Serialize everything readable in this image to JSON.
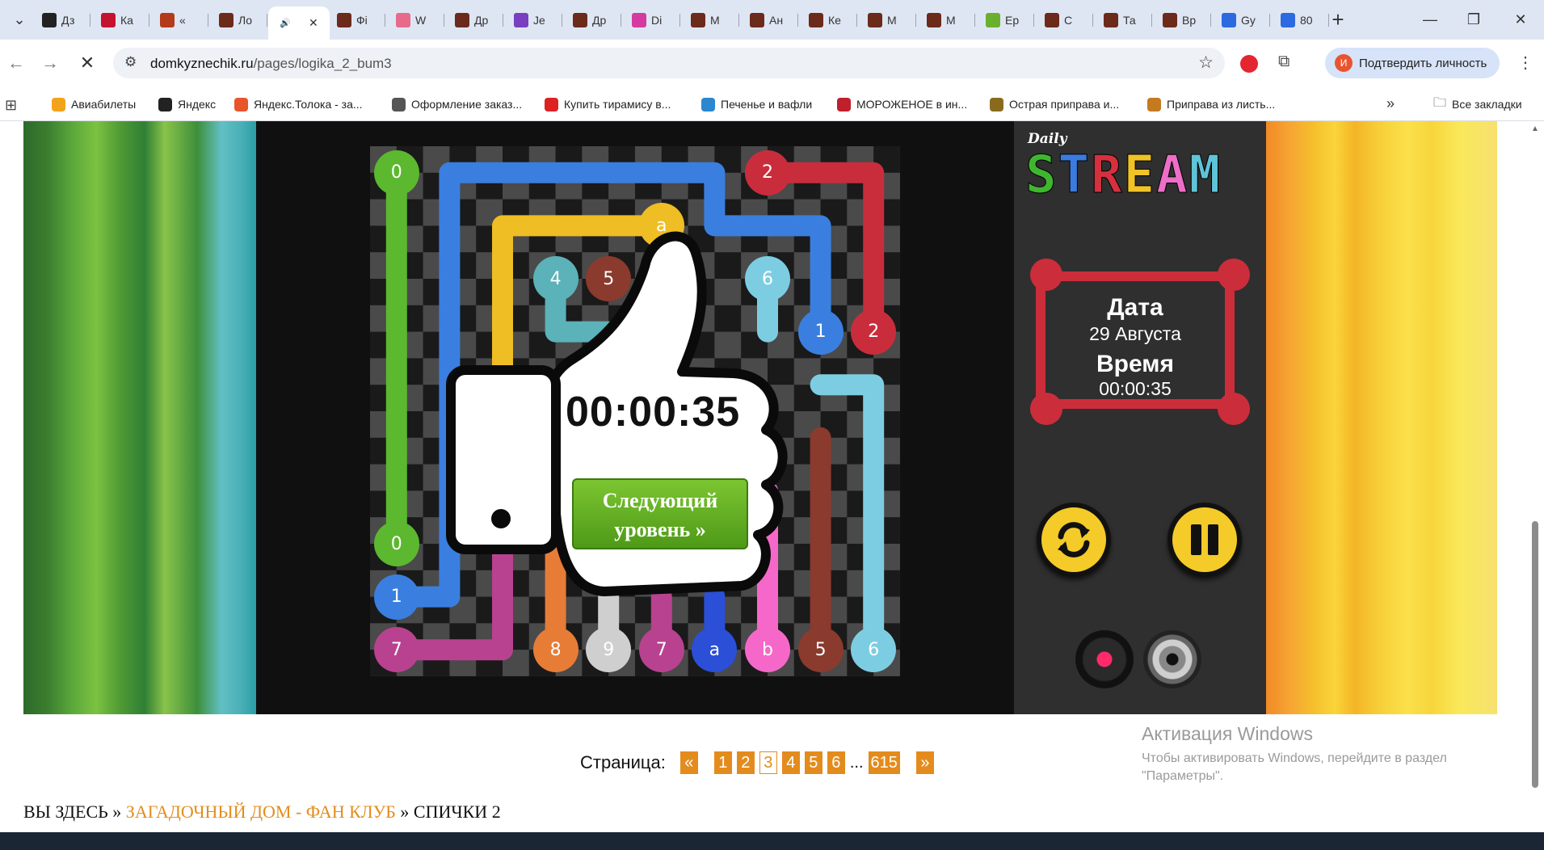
{
  "browser": {
    "tabs": [
      {
        "label": "Дз",
        "color": "#222"
      },
      {
        "label": "Ка",
        "color": "#c4122f"
      },
      {
        "label": "«",
        "color": "#b33a1a"
      },
      {
        "label": "Ло",
        "color": "#6b2a1a"
      },
      {
        "label": "",
        "color": "#555"
      },
      {
        "label": "Фі",
        "color": "#6b2a1a"
      },
      {
        "label": "W",
        "color": "#e86a8a"
      },
      {
        "label": "Др",
        "color": "#6b2a1a"
      },
      {
        "label": "Je",
        "color": "#7a3fc0"
      },
      {
        "label": "Др",
        "color": "#6b2a1a"
      },
      {
        "label": "Di",
        "color": "#d43aa0"
      },
      {
        "label": "М",
        "color": "#6b2a1a"
      },
      {
        "label": "Ан",
        "color": "#6b2a1a"
      },
      {
        "label": "Ке",
        "color": "#6b2a1a"
      },
      {
        "label": "М",
        "color": "#6b2a1a"
      },
      {
        "label": "М",
        "color": "#6b2a1a"
      },
      {
        "label": "Ер",
        "color": "#6ab02c"
      },
      {
        "label": "С",
        "color": "#6b2a1a"
      },
      {
        "label": "Та",
        "color": "#6b2a1a"
      },
      {
        "label": "Вр",
        "color": "#6b2a1a"
      },
      {
        "label": "Gy",
        "color": "#2b6ae0"
      },
      {
        "label": "80",
        "color": "#2b6ae0"
      }
    ],
    "new_tab": "+",
    "address": {
      "domain": "domkyznechik.ru",
      "path": "/pages/logika_2_bum3"
    },
    "profile_label": "Подтвердить личность",
    "profile_initial": "И",
    "bookmarks": [
      {
        "label": "Авиабилеты",
        "color": "#f2a31b"
      },
      {
        "label": "Яндекс",
        "color": "#222"
      },
      {
        "label": "Яндекс.Толока - за...",
        "color": "#e8552b"
      },
      {
        "label": "Оформление заказ...",
        "color": "#555"
      },
      {
        "label": "Купить тирамису в...",
        "color": "#d22"
      },
      {
        "label": "Печенье и вафли",
        "color": "#2a87d0"
      },
      {
        "label": "МОРОЖЕНОЕ в ин...",
        "color": "#c01f2e"
      },
      {
        "label": "Острая приправа и...",
        "color": "#8a6b1e"
      },
      {
        "label": "Приправа из листь...",
        "color": "#c47a1e"
      }
    ],
    "all_bookmarks": "Все закладки"
  },
  "game": {
    "logo_small": "Daily",
    "logo_letters": [
      {
        "ch": "S",
        "color": "#3fb62f"
      },
      {
        "ch": "T",
        "color": "#3b7be0"
      },
      {
        "ch": "R",
        "color": "#d6303e"
      },
      {
        "ch": "E",
        "color": "#f0c326"
      },
      {
        "ch": "A",
        "color": "#ec6ec6"
      },
      {
        "ch": "M",
        "color": "#5fc4d8"
      }
    ],
    "date_label": "Дата",
    "date_value": "29 Августа",
    "time_label": "Время",
    "time_value": "00:00:35",
    "result_time": "00:00:35",
    "next_level": "Следующий уровень »",
    "dots": [
      {
        "t": "0",
        "c": "#5cb82e",
        "col": 0,
        "row": 0
      },
      {
        "t": "0",
        "c": "#5cb82e",
        "col": 0,
        "row": 7
      },
      {
        "t": "1",
        "c": "#3a7fe0",
        "col": 0,
        "row": 8
      },
      {
        "t": "7",
        "c": "#b8428f",
        "col": 0,
        "row": 9
      },
      {
        "t": "2",
        "c": "#c92d3c",
        "col": 7,
        "row": 0
      },
      {
        "t": "a",
        "c": "#efbd24",
        "col": 5,
        "row": 1
      },
      {
        "t": "4",
        "c": "#5bb2b8",
        "col": 3,
        "row": 2
      },
      {
        "t": "5",
        "c": "#8b3a2e",
        "col": 4,
        "row": 2
      },
      {
        "t": "6",
        "c": "#7dcde2",
        "col": 7,
        "row": 2
      },
      {
        "t": "1",
        "c": "#3a7fe0",
        "col": 8,
        "row": 3
      },
      {
        "t": "2",
        "c": "#c92d3c",
        "col": 9,
        "row": 3
      },
      {
        "t": "8",
        "c": "#e77c36",
        "col": 3,
        "row": 9
      },
      {
        "t": "9",
        "c": "#cfcfcf",
        "col": 4,
        "row": 9
      },
      {
        "t": "7",
        "c": "#b8428f",
        "col": 5,
        "row": 9
      },
      {
        "t": "a",
        "c": "#2b4fd6",
        "col": 6,
        "row": 9
      },
      {
        "t": "b",
        "c": "#f568c9",
        "col": 7,
        "row": 9
      },
      {
        "t": "5",
        "c": "#8b3a2e",
        "col": 8,
        "row": 9
      },
      {
        "t": "6",
        "c": "#7dcde2",
        "col": 9,
        "row": 9
      }
    ]
  },
  "pager": {
    "label": "Страница:",
    "prev": "«",
    "pages": [
      "1",
      "2",
      "3",
      "4",
      "5",
      "6"
    ],
    "current": "3",
    "ellipsis": "...",
    "last": "615",
    "next": "»"
  },
  "activation": {
    "title": "Активация Windows",
    "text": "Чтобы активировать Windows, перейдите в раздел \"Параметры\"."
  },
  "breadcrumbs": {
    "prefix": "ВЫ ЗДЕСЬ »",
    "link": "ЗАГАДОЧНЫЙ ДОМ - ФАН КЛУБ",
    "sep": "»",
    "current": "СПИЧКИ 2"
  }
}
